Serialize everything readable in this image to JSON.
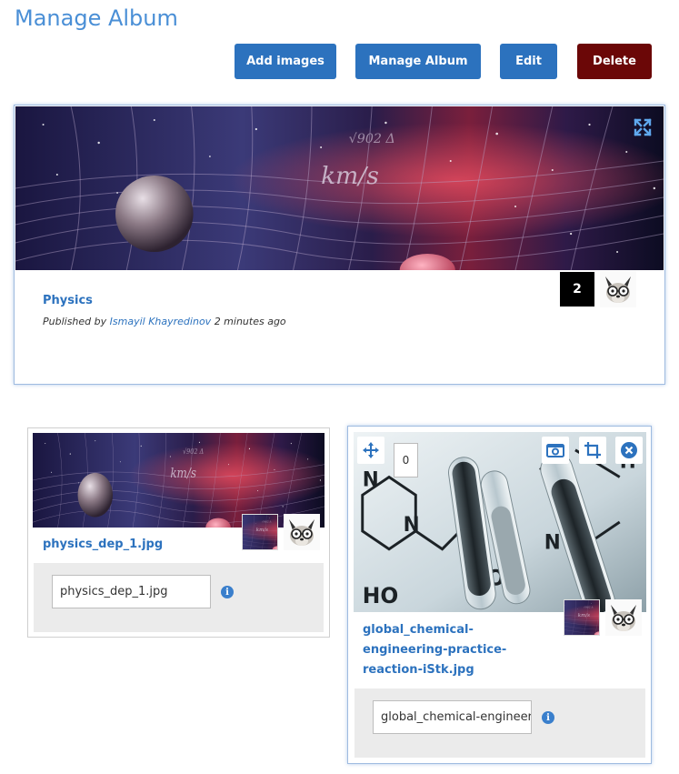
{
  "page": {
    "title": "Manage Album"
  },
  "toolbar": {
    "add_images": "Add images",
    "manage_album": "Manage Album",
    "edit": "Edit",
    "delete": "Delete"
  },
  "album": {
    "name": "Physics",
    "published_prefix": "Published by",
    "author": "Ismayil Khayredinov",
    "published_suffix": "2 minutes ago",
    "image_count": "2",
    "cover_icon": "expand-icon"
  },
  "images": [
    {
      "title": "physics_dep_1.jpg",
      "filename": "physics_dep_1.jpg"
    },
    {
      "title": "global_chemical-engineering-practice-reaction-iStk.jpg",
      "title_lines": [
        "global_chemical-",
        "engineering-practice-",
        "reaction-iStk.jpg"
      ],
      "filename": "global_chemical-engineering-practice-reaction-iStk.jpg",
      "order": "0"
    }
  ],
  "colors": {
    "accent": "#2c72be",
    "delete": "#6b0707",
    "title": "#4a8fd6"
  }
}
